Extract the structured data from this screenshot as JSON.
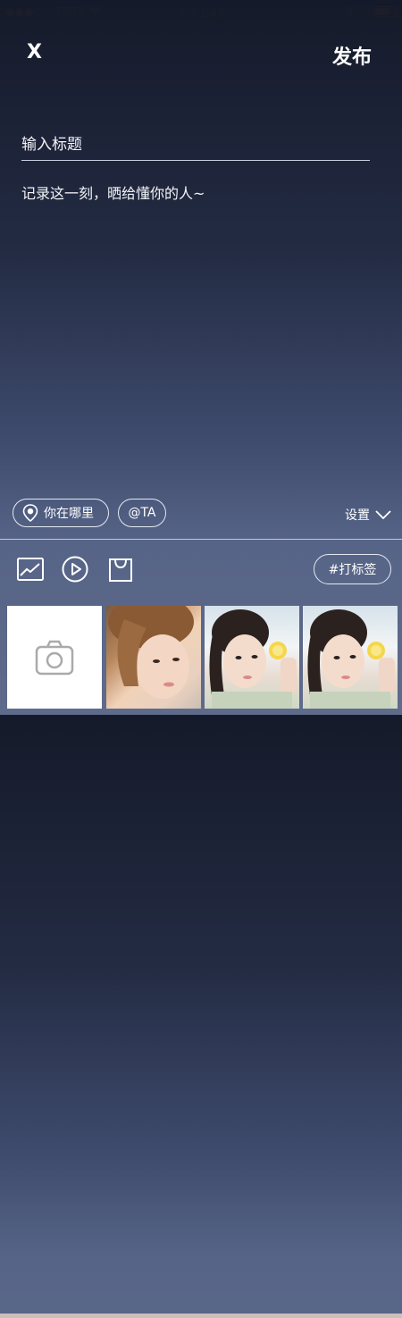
{
  "status_bar": {
    "signal_dots": "●●●○○",
    "carrier": "TIETA",
    "time": "下午1:43",
    "battery_pct": "80%",
    "battery_level": 0.8
  },
  "header": {
    "close_label": "X",
    "publish_label": "发布"
  },
  "editor": {
    "title_placeholder": "输入标题",
    "content_placeholder": "记录这一刻，晒给懂你的人~"
  },
  "chips": {
    "location_label": "你在哪里",
    "mention_label": "@TA"
  },
  "settings_label": "设置",
  "toolbar": {
    "tag_label": "#打标签"
  },
  "colors": {
    "bg_top": "#151a2a",
    "bg_bottom": "#5f6b8a",
    "accent": "#ffffff"
  },
  "icons": [
    "location-pin-icon",
    "chevron-down-icon",
    "image-icon",
    "play-icon",
    "shopping-bag-icon",
    "camera-icon",
    "wifi-icon"
  ]
}
